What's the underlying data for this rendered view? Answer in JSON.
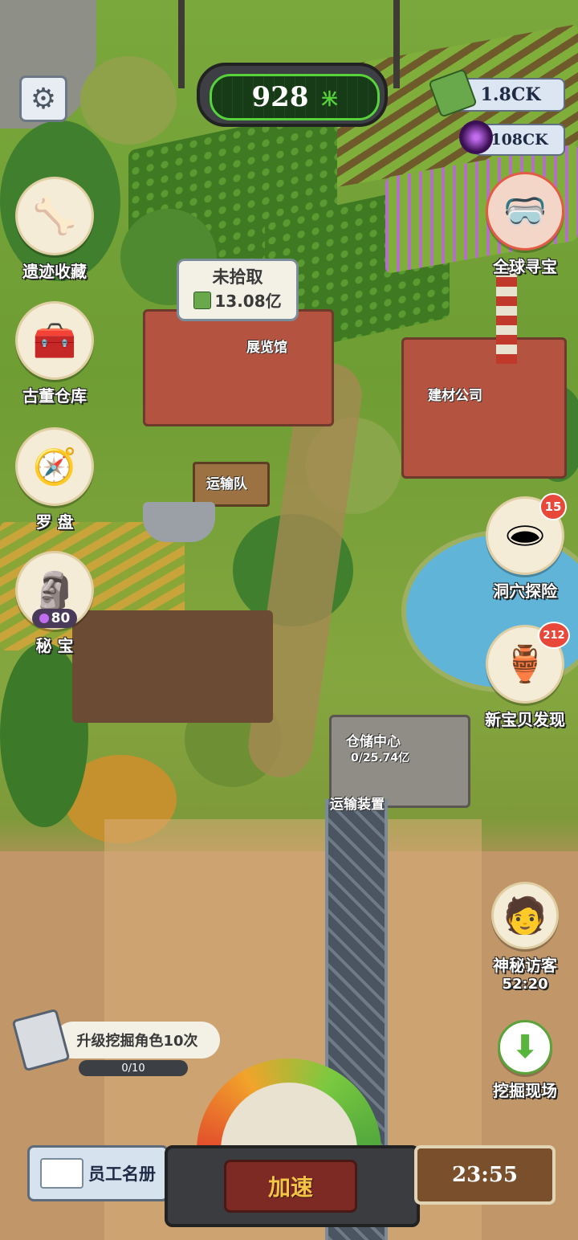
{
  "counter": {
    "value": "928",
    "unit": "米"
  },
  "currency": {
    "cash": "1.8CK",
    "gems": "108CK"
  },
  "left_menu": [
    {
      "label": "遗迹收藏",
      "icon": "dinosaur-fossil-icon"
    },
    {
      "label": "古董仓库",
      "icon": "treasure-chest-icon"
    },
    {
      "label": "罗 盘",
      "icon": "compass-icon"
    },
    {
      "label": "秘 宝",
      "icon": "buddha-statue-icon",
      "cost": "80"
    }
  ],
  "right_menu": [
    {
      "label": "全球寻宝",
      "icon": "vr-headset-icon"
    },
    {
      "label": "洞穴探险",
      "icon": "cave-icon",
      "badge": "15"
    },
    {
      "label": "新宝贝发现",
      "icon": "bronze-vessel-icon",
      "badge": "212"
    },
    {
      "label": "神秘访客",
      "icon": "visitor-avatar-icon",
      "timer": "52:20"
    },
    {
      "label": "挖掘现场",
      "icon": "down-arrow-icon"
    }
  ],
  "bubble": {
    "title": "未拾取",
    "amount": "13.08亿"
  },
  "map_labels": {
    "museum": "展览馆",
    "building_company": "建材公司",
    "transport_team": "运输队",
    "warehouse": "仓储中心",
    "warehouse_amount": "0/25.74亿",
    "transport_device": "运输装置"
  },
  "task": {
    "label": "升级挖掘角色10次",
    "progress": "0/10",
    "progress_fraction": 0
  },
  "bottom": {
    "staff": "员工名册",
    "speed": "加速",
    "timer": "23:55"
  },
  "colors": {
    "counter_bg": "#1b2a1b",
    "counter_text": "#ffffff",
    "accent_green": "#57d33b",
    "badge_red": "#e8483a"
  }
}
